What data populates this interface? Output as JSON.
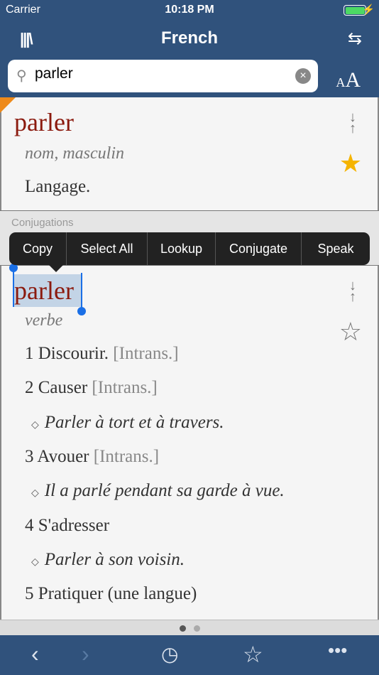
{
  "status": {
    "carrier": "Carrier",
    "time": "10:18 PM"
  },
  "header": {
    "title": "French",
    "library_icon": "library-icon",
    "swap_icon": "swap-language-icon"
  },
  "search": {
    "value": "parler",
    "placeholder": ""
  },
  "font_size": {
    "small": "A",
    "big": "A"
  },
  "entries": [
    {
      "headword": "parler",
      "pos": "nom, masculin",
      "definition": "Langage.",
      "favorited": true
    },
    {
      "headword": "parler",
      "pos": "verbe",
      "favorited": false,
      "senses": [
        {
          "num": "1",
          "text": "Discourir.",
          "gram": "[Intrans.]"
        },
        {
          "num": "2",
          "text": "Causer",
          "gram": "[Intrans.]",
          "example": "Parler à tort et à travers."
        },
        {
          "num": "3",
          "text": "Avouer",
          "gram": "[Intrans.]",
          "example": "Il a parlé pendant sa garde à vue."
        },
        {
          "num": "4",
          "text": "S'adresser",
          "example": "Parler à son voisin."
        },
        {
          "num": "5",
          "text": "Pratiquer (une langue)"
        }
      ]
    }
  ],
  "conjugations_label": "Conjugations",
  "context_menu": [
    "Copy",
    "Select All",
    "Lookup",
    "Conjugate",
    "Speak"
  ],
  "pager": {
    "current": 1,
    "total": 2
  },
  "toolbar": {
    "back": "back-icon",
    "forward": "forward-icon",
    "history": "history-icon",
    "favorites": "favorites-icon",
    "more": "more-icon"
  },
  "colors": {
    "bar": "#30527c",
    "headword": "#8b1a0e",
    "star": "#f5b400"
  }
}
